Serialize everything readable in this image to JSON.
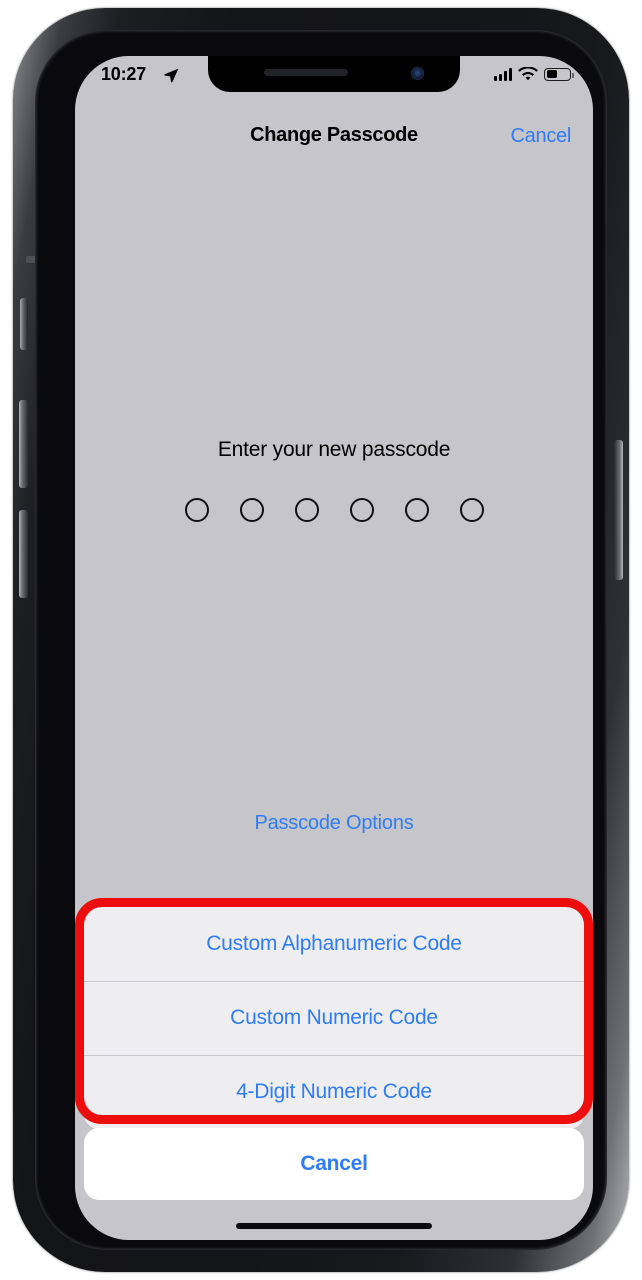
{
  "status_bar": {
    "time": "10:27",
    "location_arrow_icon": "location-arrow-icon",
    "cellular_icon": "cellular-bars-icon",
    "wifi_icon": "wifi-icon",
    "battery_icon": "battery-icon",
    "battery_level_percent": 52
  },
  "nav": {
    "title": "Change Passcode",
    "cancel_label": "Cancel"
  },
  "passcode": {
    "prompt": "Enter your new passcode",
    "dot_count": 6,
    "filled_count": 0
  },
  "options_link": {
    "label": "Passcode Options"
  },
  "action_sheet": {
    "options": [
      {
        "label": "Custom Alphanumeric Code"
      },
      {
        "label": "Custom Numeric Code"
      },
      {
        "label": "4-Digit Numeric Code"
      }
    ],
    "cancel_label": "Cancel"
  },
  "annotation": {
    "highlight_color": "#ee0d0d",
    "shape": "rounded-rectangle"
  },
  "colors": {
    "screen_background": "#c6c6ca",
    "accent_blue": "#2f7cf6",
    "sheet_fill": "#eeeef0",
    "cancel_fill": "#ffffff",
    "separator": "#c9c9cd",
    "text_primary": "#000000"
  },
  "device": {
    "home_indicator": "home-indicator",
    "notch": "notch"
  }
}
